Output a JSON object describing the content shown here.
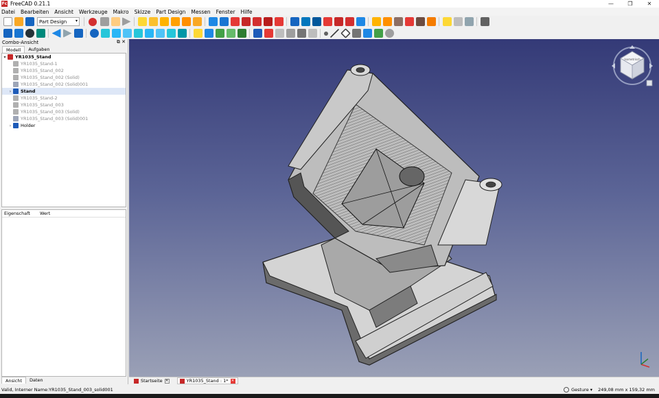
{
  "window": {
    "title": "FreeCAD 0.21.1",
    "app_icon": "Fc",
    "controls": {
      "minimize": "—",
      "maximize": "❐",
      "close": "✕"
    }
  },
  "menu": {
    "items": [
      "Datei",
      "Bearbeiten",
      "Ansicht",
      "Werkzeuge",
      "Makro",
      "Skizze",
      "Part Design",
      "Messen",
      "Fenster",
      "Hilfe"
    ]
  },
  "toolbar": {
    "workbench": "Part Design",
    "icon_colors": [
      "#1e88e5",
      "#fdd835",
      "#1565c0",
      "#8e24aa",
      "#e53935",
      "#ffb300",
      "#4caf50",
      "#d32f2f",
      "#0277bd",
      "#fbc02d",
      "#7b1fa2",
      "#c62828",
      "#00897b",
      "#9e9e9e"
    ]
  },
  "combo": {
    "title": "Combo-Ansicht",
    "tabs": [
      "Modell",
      "Aufgaben"
    ],
    "tree": [
      {
        "label": "YR1035_Stand",
        "state": "root",
        "icon": "#c62828",
        "expander": "▾"
      },
      {
        "label": "YR1035_Stand-1",
        "state": "dim",
        "icon": "#b0b0b0",
        "expander": ""
      },
      {
        "label": "YR1035_Stand_002",
        "state": "dim",
        "icon": "#b0b0b0",
        "expander": ""
      },
      {
        "label": "YR1035_Stand_002 (Solid)",
        "state": "dim",
        "icon": "#b0b0b0",
        "expander": ""
      },
      {
        "label": "YR1035_Stand_002 (Solid)001",
        "state": "dim",
        "icon": "#9ea6b8",
        "expander": ""
      },
      {
        "label": "Stand",
        "state": "sel",
        "icon": "#1e5bb8",
        "expander": "›"
      },
      {
        "label": "YR1035_Stand-2",
        "state": "dim",
        "icon": "#b0b0b0",
        "expander": ""
      },
      {
        "label": "YR1035_Stand_003",
        "state": "dim",
        "icon": "#b0b0b0",
        "expander": ""
      },
      {
        "label": "YR1035_Stand_003 (Solid)",
        "state": "dim",
        "icon": "#b0b0b0",
        "expander": ""
      },
      {
        "label": "YR1035_Stand_003 (Solid)001",
        "state": "dim",
        "icon": "#9ea6b8",
        "expander": ""
      },
      {
        "label": "Holder",
        "state": "normal",
        "icon": "#1e5bb8",
        "expander": "›"
      }
    ],
    "properties": {
      "col_property": "Eigenschaft",
      "col_value": "Wert"
    },
    "bottom_tabs": [
      "Ansicht",
      "Daten"
    ]
  },
  "navcube": {
    "face": "Isometrisch"
  },
  "doc_tabs": [
    {
      "label": "Startseite",
      "active": false
    },
    {
      "label": "YR1035_Stand : 1*",
      "active": true
    }
  ],
  "status": {
    "message": "Valid, Interner Name:YR1035_Stand_003_solid001",
    "nav_style": "Gesture",
    "dimensions": "249,08 mm x 159,32 mm"
  }
}
